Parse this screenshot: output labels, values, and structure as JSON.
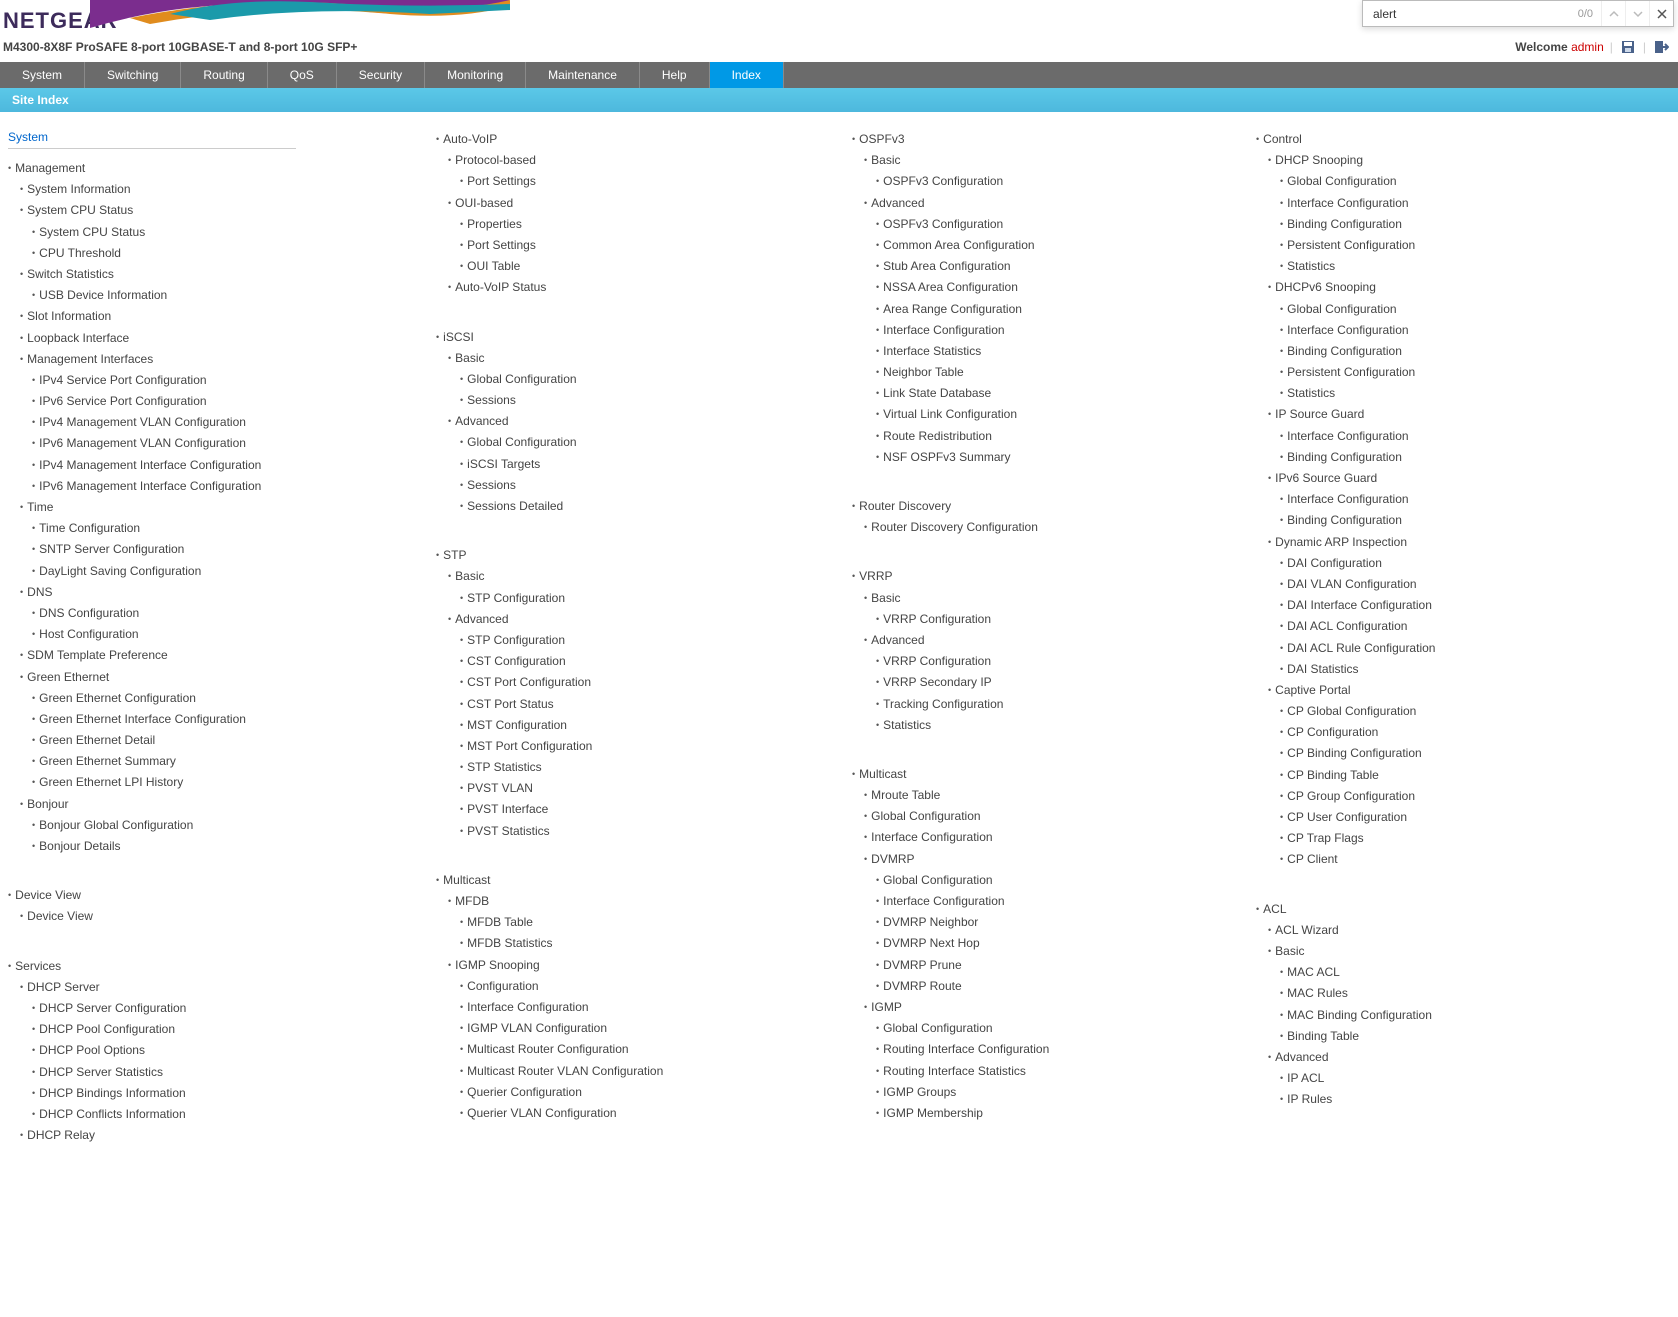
{
  "logo": "NETGEAR",
  "product": "M4300-8X8F ProSAFE 8-port 10GBASE-T and 8-port 10G SFP+",
  "welcome": {
    "label": "Welcome",
    "user": "admin"
  },
  "search": {
    "value": "alert",
    "count": "0/0"
  },
  "nav": [
    "System",
    "Switching",
    "Routing",
    "QoS",
    "Security",
    "Monitoring",
    "Maintenance",
    "Help",
    "Index"
  ],
  "subnav": "Site Index",
  "category": "System",
  "cols": [
    [
      {
        "t": "Management",
        "l": 1
      },
      {
        "t": "System Information",
        "l": 2
      },
      {
        "t": "System CPU Status",
        "l": 2
      },
      {
        "t": "System CPU Status",
        "l": 3
      },
      {
        "t": "CPU Threshold",
        "l": 3
      },
      {
        "t": "Switch Statistics",
        "l": 2
      },
      {
        "t": "USB Device Information",
        "l": 3
      },
      {
        "t": "Slot Information",
        "l": 2
      },
      {
        "t": "Loopback Interface",
        "l": 2
      },
      {
        "t": "Management Interfaces",
        "l": 2
      },
      {
        "t": "IPv4 Service Port Configuration",
        "l": 3
      },
      {
        "t": "IPv6 Service Port Configuration",
        "l": 3
      },
      {
        "t": "IPv4 Management VLAN Configuration",
        "l": 3
      },
      {
        "t": "IPv6 Management VLAN Configuration",
        "l": 3
      },
      {
        "t": "IPv4 Management Interface Configuration",
        "l": 3
      },
      {
        "t": "IPv6 Management Interface Configuration",
        "l": 3
      },
      {
        "t": "Time",
        "l": 2
      },
      {
        "t": "Time Configuration",
        "l": 3
      },
      {
        "t": "SNTP Server Configuration",
        "l": 3
      },
      {
        "t": "DayLight Saving Configuration",
        "l": 3
      },
      {
        "t": "DNS",
        "l": 2
      },
      {
        "t": "DNS Configuration",
        "l": 3
      },
      {
        "t": "Host Configuration",
        "l": 3
      },
      {
        "t": "SDM Template Preference",
        "l": 2
      },
      {
        "t": "Green Ethernet",
        "l": 2
      },
      {
        "t": "Green Ethernet Configuration",
        "l": 3
      },
      {
        "t": "Green Ethernet Interface Configuration",
        "l": 3
      },
      {
        "t": "Green Ethernet Detail",
        "l": 3
      },
      {
        "t": "Green Ethernet Summary",
        "l": 3
      },
      {
        "t": "Green Ethernet LPI History",
        "l": 3
      },
      {
        "t": "Bonjour",
        "l": 2
      },
      {
        "t": "Bonjour Global Configuration",
        "l": 3
      },
      {
        "t": "Bonjour Details",
        "l": 3
      },
      {
        "sp": 1
      },
      {
        "t": "Device View",
        "l": 1
      },
      {
        "t": "Device View",
        "l": 2
      },
      {
        "sp": 1
      },
      {
        "t": "Services",
        "l": 1
      },
      {
        "t": "DHCP Server",
        "l": 2
      },
      {
        "t": "DHCP Server Configuration",
        "l": 3
      },
      {
        "t": "DHCP Pool Configuration",
        "l": 3
      },
      {
        "t": "DHCP Pool Options",
        "l": 3
      },
      {
        "t": "DHCP Server Statistics",
        "l": 3
      },
      {
        "t": "DHCP Bindings Information",
        "l": 3
      },
      {
        "t": "DHCP Conflicts Information",
        "l": 3
      },
      {
        "t": "DHCP Relay",
        "l": 2
      }
    ],
    [
      {
        "t": "Auto-VoIP",
        "l": 2
      },
      {
        "t": "Protocol-based",
        "l": 3
      },
      {
        "t": "Port Settings",
        "l": 4
      },
      {
        "t": "OUI-based",
        "l": 3
      },
      {
        "t": "Properties",
        "l": 4
      },
      {
        "t": "Port Settings",
        "l": 4
      },
      {
        "t": "OUI Table",
        "l": 4
      },
      {
        "t": "Auto-VoIP Status",
        "l": 3
      },
      {
        "sp": 1
      },
      {
        "t": "iSCSI",
        "l": 2
      },
      {
        "t": "Basic",
        "l": 3
      },
      {
        "t": "Global Configuration",
        "l": 4
      },
      {
        "t": "Sessions",
        "l": 4
      },
      {
        "t": "Advanced",
        "l": 3
      },
      {
        "t": "Global Configuration",
        "l": 4
      },
      {
        "t": "iSCSI Targets",
        "l": 4
      },
      {
        "t": "Sessions",
        "l": 4
      },
      {
        "t": "Sessions Detailed",
        "l": 4
      },
      {
        "sp": 1
      },
      {
        "t": "STP",
        "l": 2
      },
      {
        "t": "Basic",
        "l": 3
      },
      {
        "t": "STP Configuration",
        "l": 4
      },
      {
        "t": "Advanced",
        "l": 3
      },
      {
        "t": "STP Configuration",
        "l": 4
      },
      {
        "t": "CST Configuration",
        "l": 4
      },
      {
        "t": "CST Port Configuration",
        "l": 4
      },
      {
        "t": "CST Port Status",
        "l": 4
      },
      {
        "t": "MST Configuration",
        "l": 4
      },
      {
        "t": "MST Port Configuration",
        "l": 4
      },
      {
        "t": "STP Statistics",
        "l": 4
      },
      {
        "t": "PVST VLAN",
        "l": 4
      },
      {
        "t": "PVST Interface",
        "l": 4
      },
      {
        "t": "PVST Statistics",
        "l": 4
      },
      {
        "sp": 1
      },
      {
        "t": "Multicast",
        "l": 2
      },
      {
        "t": "MFDB",
        "l": 3
      },
      {
        "t": "MFDB Table",
        "l": 4
      },
      {
        "t": "MFDB Statistics",
        "l": 4
      },
      {
        "t": "IGMP Snooping",
        "l": 3
      },
      {
        "t": "Configuration",
        "l": 4
      },
      {
        "t": "Interface Configuration",
        "l": 4
      },
      {
        "t": "IGMP VLAN Configuration",
        "l": 4
      },
      {
        "t": "Multicast Router Configuration",
        "l": 4
      },
      {
        "t": "Multicast Router VLAN Configuration",
        "l": 4
      },
      {
        "t": "Querier Configuration",
        "l": 4
      },
      {
        "t": "Querier VLAN Configuration",
        "l": 4
      }
    ],
    [
      {
        "t": "OSPFv3",
        "l": 2
      },
      {
        "t": "Basic",
        "l": 3
      },
      {
        "t": "OSPFv3 Configuration",
        "l": 4
      },
      {
        "t": "Advanced",
        "l": 3
      },
      {
        "t": "OSPFv3 Configuration",
        "l": 4
      },
      {
        "t": "Common Area Configuration",
        "l": 4
      },
      {
        "t": "Stub Area Configuration",
        "l": 4
      },
      {
        "t": "NSSA Area Configuration",
        "l": 4
      },
      {
        "t": "Area Range Configuration",
        "l": 4
      },
      {
        "t": "Interface Configuration",
        "l": 4
      },
      {
        "t": "Interface Statistics",
        "l": 4
      },
      {
        "t": "Neighbor Table",
        "l": 4
      },
      {
        "t": "Link State Database",
        "l": 4
      },
      {
        "t": "Virtual Link Configuration",
        "l": 4
      },
      {
        "t": "Route Redistribution",
        "l": 4
      },
      {
        "t": "NSF OSPFv3 Summary",
        "l": 4
      },
      {
        "sp": 1
      },
      {
        "t": "Router Discovery",
        "l": 2
      },
      {
        "t": "Router Discovery Configuration",
        "l": 3
      },
      {
        "sp": 1
      },
      {
        "t": "VRRP",
        "l": 2
      },
      {
        "t": "Basic",
        "l": 3
      },
      {
        "t": "VRRP Configuration",
        "l": 4
      },
      {
        "t": "Advanced",
        "l": 3
      },
      {
        "t": "VRRP Configuration",
        "l": 4
      },
      {
        "t": "VRRP Secondary IP",
        "l": 4
      },
      {
        "t": "Tracking Configuration",
        "l": 4
      },
      {
        "t": "Statistics",
        "l": 4
      },
      {
        "sp": 1
      },
      {
        "t": "Multicast",
        "l": 2
      },
      {
        "t": "Mroute Table",
        "l": 3
      },
      {
        "t": "Global Configuration",
        "l": 3
      },
      {
        "t": "Interface Configuration",
        "l": 3
      },
      {
        "t": "DVMRP",
        "l": 3
      },
      {
        "t": "Global Configuration",
        "l": 4
      },
      {
        "t": "Interface Configuration",
        "l": 4
      },
      {
        "t": "DVMRP Neighbor",
        "l": 4
      },
      {
        "t": "DVMRP Next Hop",
        "l": 4
      },
      {
        "t": "DVMRP Prune",
        "l": 4
      },
      {
        "t": "DVMRP Route",
        "l": 4
      },
      {
        "t": "IGMP",
        "l": 3
      },
      {
        "t": "Global Configuration",
        "l": 4
      },
      {
        "t": "Routing Interface Configuration",
        "l": 4
      },
      {
        "t": "Routing Interface Statistics",
        "l": 4
      },
      {
        "t": "IGMP Groups",
        "l": 4
      },
      {
        "t": "IGMP Membership",
        "l": 4
      }
    ],
    [
      {
        "t": "Control",
        "l": 1
      },
      {
        "t": "DHCP Snooping",
        "l": 2
      },
      {
        "t": "Global Configuration",
        "l": 3
      },
      {
        "t": "Interface Configuration",
        "l": 3
      },
      {
        "t": "Binding Configuration",
        "l": 3
      },
      {
        "t": "Persistent Configuration",
        "l": 3
      },
      {
        "t": "Statistics",
        "l": 3
      },
      {
        "t": "DHCPv6 Snooping",
        "l": 2
      },
      {
        "t": "Global Configuration",
        "l": 3
      },
      {
        "t": "Interface Configuration",
        "l": 3
      },
      {
        "t": "Binding Configuration",
        "l": 3
      },
      {
        "t": "Persistent Configuration",
        "l": 3
      },
      {
        "t": "Statistics",
        "l": 3
      },
      {
        "t": "IP Source Guard",
        "l": 2
      },
      {
        "t": "Interface Configuration",
        "l": 3
      },
      {
        "t": "Binding Configuration",
        "l": 3
      },
      {
        "t": "IPv6 Source Guard",
        "l": 2
      },
      {
        "t": "Interface Configuration",
        "l": 3
      },
      {
        "t": "Binding Configuration",
        "l": 3
      },
      {
        "t": "Dynamic ARP Inspection",
        "l": 2
      },
      {
        "t": "DAI Configuration",
        "l": 3
      },
      {
        "t": "DAI VLAN Configuration",
        "l": 3
      },
      {
        "t": "DAI Interface Configuration",
        "l": 3
      },
      {
        "t": "DAI ACL Configuration",
        "l": 3
      },
      {
        "t": "DAI ACL Rule Configuration",
        "l": 3
      },
      {
        "t": "DAI Statistics",
        "l": 3
      },
      {
        "t": "Captive Portal",
        "l": 2
      },
      {
        "t": "CP Global Configuration",
        "l": 3
      },
      {
        "t": "CP Configuration",
        "l": 3
      },
      {
        "t": "CP Binding Configuration",
        "l": 3
      },
      {
        "t": "CP Binding Table",
        "l": 3
      },
      {
        "t": "CP Group Configuration",
        "l": 3
      },
      {
        "t": "CP User Configuration",
        "l": 3
      },
      {
        "t": "CP Trap Flags",
        "l": 3
      },
      {
        "t": "CP Client",
        "l": 3
      },
      {
        "sp": 1
      },
      {
        "t": "ACL",
        "l": 1
      },
      {
        "t": "ACL Wizard",
        "l": 2
      },
      {
        "t": "Basic",
        "l": 2
      },
      {
        "t": "MAC ACL",
        "l": 3
      },
      {
        "t": "MAC Rules",
        "l": 3
      },
      {
        "t": "MAC Binding Configuration",
        "l": 3
      },
      {
        "t": "Binding Table",
        "l": 3
      },
      {
        "t": "Advanced",
        "l": 2
      },
      {
        "t": "IP ACL",
        "l": 3
      },
      {
        "t": "IP Rules",
        "l": 3
      }
    ]
  ]
}
